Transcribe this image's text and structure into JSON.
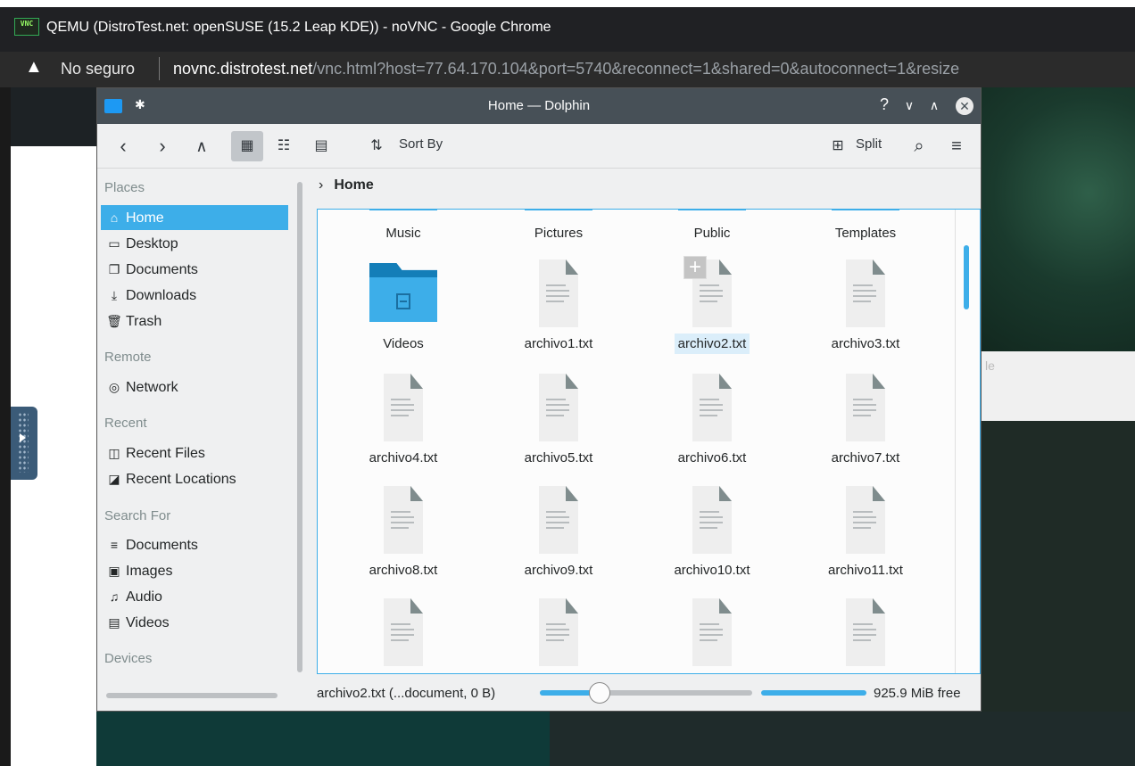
{
  "browser": {
    "window_title": "QEMU (DistroTest.net: openSUSE (15.2 Leap KDE)) - noVNC - Google Chrome",
    "logo_text": "VNC",
    "security_label": "No seguro",
    "url_host": "novnc.distrotest.net",
    "url_path": "/vnc.html?host=77.64.170.104&port=5740&reconnect=1&shared=0&autoconnect=1&resize"
  },
  "background": {
    "partial_text": "le"
  },
  "dolphin": {
    "title": "Home — Dolphin",
    "toolbar": {
      "sort_label": "Sort By",
      "split_label": "Split"
    },
    "places": {
      "sections": {
        "places": "Places",
        "remote": "Remote",
        "recent": "Recent",
        "search_for": "Search For",
        "devices": "Devices"
      },
      "items": {
        "home": "Home",
        "desktop": "Desktop",
        "documents": "Documents",
        "downloads": "Downloads",
        "trash": "Trash",
        "network": "Network",
        "recent_files": "Recent Files",
        "recent_locations": "Recent Locations",
        "search_documents": "Documents",
        "search_images": "Images",
        "search_audio": "Audio",
        "search_videos": "Videos"
      }
    },
    "breadcrumb": "Home",
    "files": {
      "music": "Music",
      "pictures": "Pictures",
      "public": "Public",
      "templates": "Templates",
      "videos": "Videos",
      "f1": "archivo1.txt",
      "f2": "archivo2.txt",
      "f3": "archivo3.txt",
      "f4": "archivo4.txt",
      "f5": "archivo5.txt",
      "f6": "archivo6.txt",
      "f7": "archivo7.txt",
      "f8": "archivo8.txt",
      "f9": "archivo9.txt",
      "f10": "archivo10.txt",
      "f11": "archivo11.txt"
    },
    "status": {
      "selection": "archivo2.txt (...document, 0 B)",
      "zoom_fraction": 0.28,
      "free_space": "925.9 MiB free"
    }
  }
}
